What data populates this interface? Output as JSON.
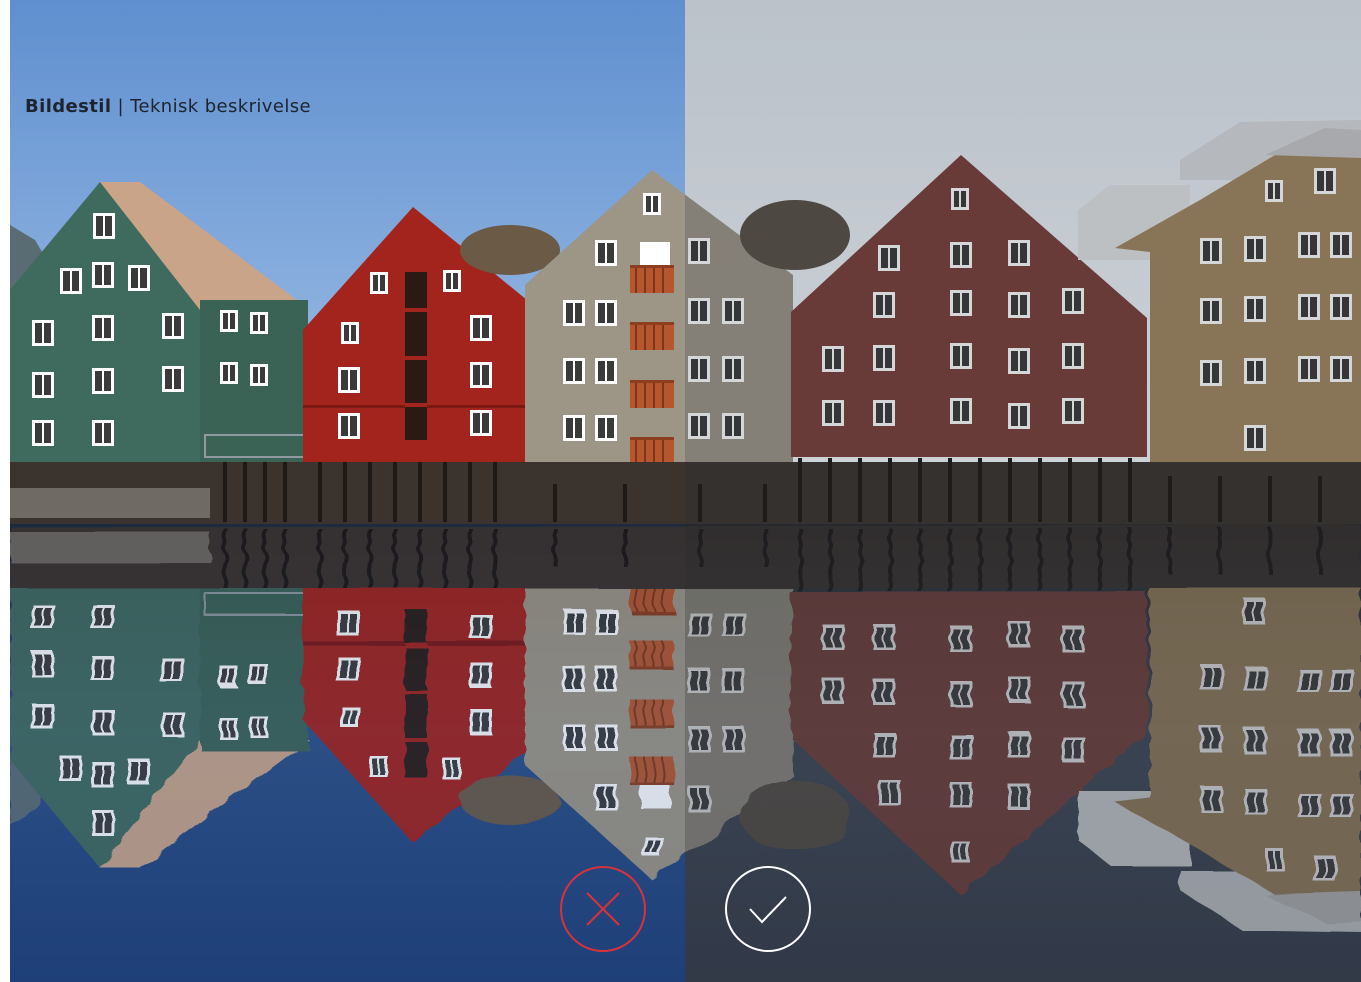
{
  "caption": {
    "title_bold": "Bildestil",
    "separator": " | ",
    "title_rest": "Teknisk beskrivelse"
  },
  "comparison": {
    "left_variant": "vivid color grade",
    "right_variant": "muted color grade"
  },
  "buttons": {
    "reject": {
      "icon": "close-icon",
      "color": "#d9323a"
    },
    "accept": {
      "icon": "checkmark-icon",
      "color": "#ffffff"
    }
  },
  "colors": {
    "green_house": "#3f6a5e",
    "red_house": "#a3241c",
    "gray_house": "#9d9585",
    "maroon_house": "#8b3a34",
    "ochre_house": "#a98650",
    "window": "#ffffff"
  }
}
